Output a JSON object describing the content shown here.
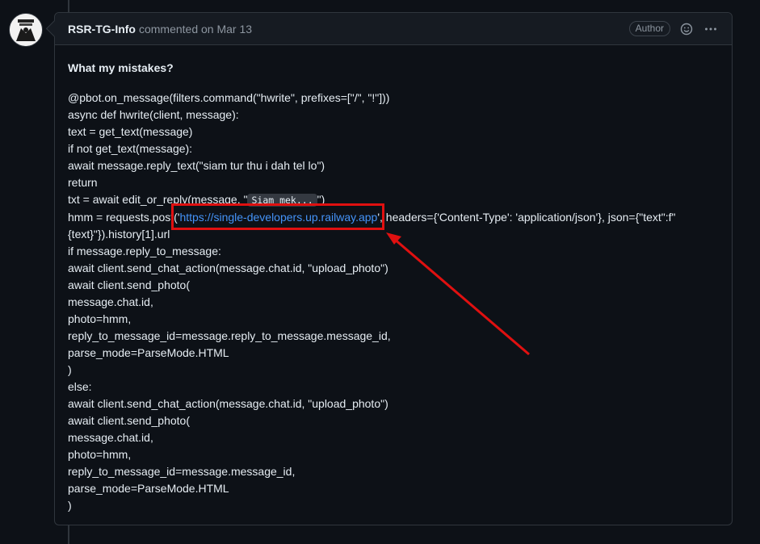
{
  "comment": {
    "author": "RSR-TG-Info",
    "meta": "commented on Mar 13",
    "badge": "Author",
    "icons": {
      "reaction": "smiley-icon",
      "more": "kebab-horizontal-icon"
    }
  },
  "body": {
    "question": "What my mistakes?",
    "lines": [
      "@pbot.on_message(filters.command(\"hwrite\", prefixes=[\"/\", \"!\"]))",
      "async def hwrite(client, message):",
      "text = get_text(message)",
      "if not get_text(message):",
      "await message.reply_text(\"siam tur thu i dah tel lo\")",
      "return"
    ],
    "txt_line": {
      "prefix": "txt = await edit_or_reply(message, \"",
      "code": "Siam mek...",
      "suffix": "\")"
    },
    "hmm_line": {
      "prefix": "hmm = requests.post('",
      "url": "https://single-developers.up.railway.app",
      "suffix": "', headers={'Content-Type': 'application/json'}, json={\"text\":f\"{text}\"}).history[1].url"
    },
    "rest_lines": [
      "if message.reply_to_message:",
      "await client.send_chat_action(message.chat.id, \"upload_photo\")",
      "await client.send_photo(",
      "message.chat.id,",
      "photo=hmm,",
      "reply_to_message_id=message.reply_to_message.message_id,",
      "parse_mode=ParseMode.HTML",
      ")",
      "else:",
      "await client.send_chat_action(message.chat.id, \"upload_photo\")",
      "await client.send_photo(",
      "message.chat.id,",
      "photo=hmm,",
      "reply_to_message_id=message.message_id,",
      "parse_mode=ParseMode.HTML",
      ")"
    ]
  },
  "annotation": {
    "highlight_color": "#e01010"
  },
  "colors": {
    "background": "#0d1117",
    "link": "#4493f8",
    "border": "#30363d"
  }
}
